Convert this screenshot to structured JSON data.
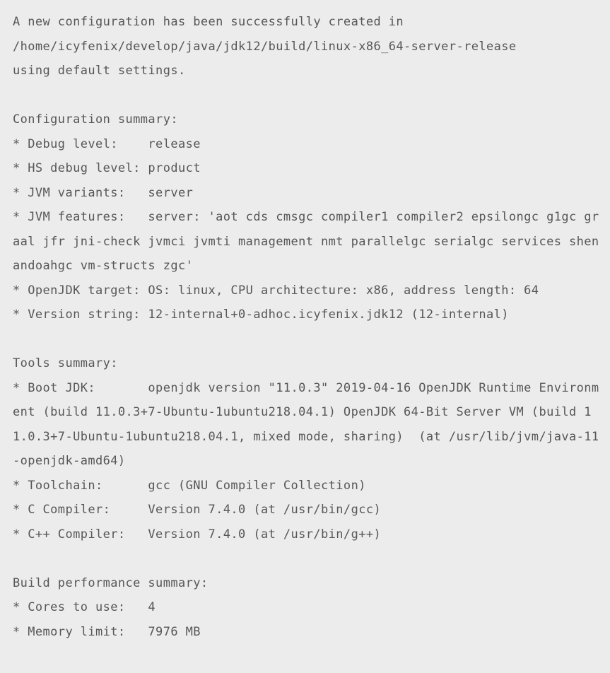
{
  "output": "A new configuration has been successfully created in\n/home/icyfenix/develop/java/jdk12/build/linux-x86_64-server-release\nusing default settings.\n\nConfiguration summary:\n* Debug level:    release\n* HS debug level: product\n* JVM variants:   server\n* JVM features:   server: 'aot cds cmsgc compiler1 compiler2 epsilongc g1gc graal jfr jni-check jvmci jvmti management nmt parallelgc serialgc services shenandoahgc vm-structs zgc'\n* OpenJDK target: OS: linux, CPU architecture: x86, address length: 64\n* Version string: 12-internal+0-adhoc.icyfenix.jdk12 (12-internal)\n\nTools summary:\n* Boot JDK:       openjdk version \"11.0.3\" 2019-04-16 OpenJDK Runtime Environment (build 11.0.3+7-Ubuntu-1ubuntu218.04.1) OpenJDK 64-Bit Server VM (build 11.0.3+7-Ubuntu-1ubuntu218.04.1, mixed mode, sharing)  (at /usr/lib/jvm/java-11-openjdk-amd64)\n* Toolchain:      gcc (GNU Compiler Collection)\n* C Compiler:     Version 7.4.0 (at /usr/bin/gcc)\n* C++ Compiler:   Version 7.4.0 (at /usr/bin/g++)\n\nBuild performance summary:\n* Cores to use:   4\n* Memory limit:   7976 MB"
}
